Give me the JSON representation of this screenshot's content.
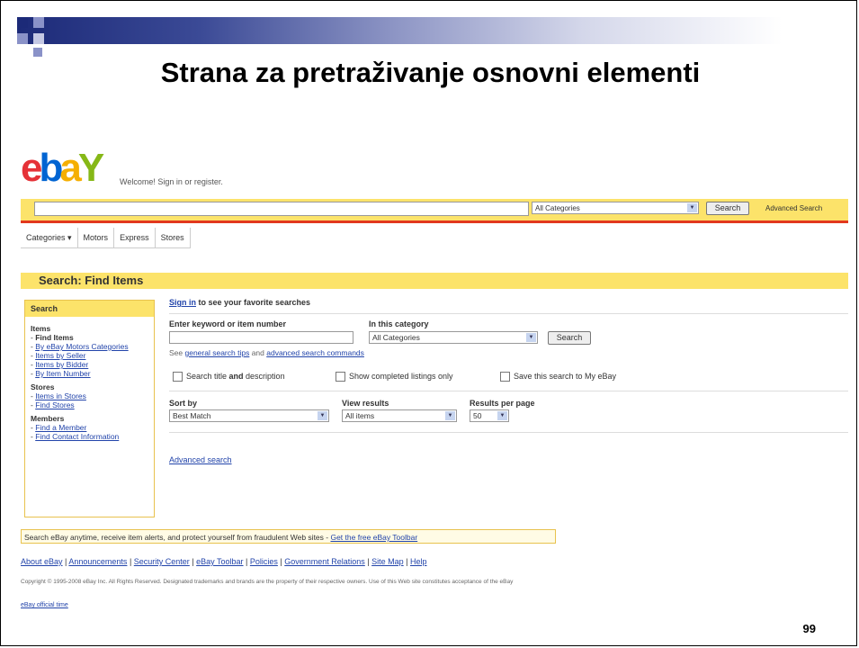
{
  "slide": {
    "title": "Strana za pretraživanje osnovni elementi",
    "page_number": "99"
  },
  "ebay": {
    "logo": {
      "e": "e",
      "b": "b",
      "a": "a",
      "y": "Y"
    },
    "welcome": "Welcome! Sign in or register.",
    "search_bar": {
      "category": "All Categories",
      "search_button": "Search",
      "advanced_link": "Advanced Search"
    },
    "nav_tabs": [
      "Categories ▾",
      "Motors",
      "Express",
      "Stores"
    ],
    "find_header": "Search: Find Items",
    "sidebar": {
      "header": "Search",
      "items_title": "Items",
      "items": [
        "Find Items",
        "By eBay Motors Categories",
        "Items by Seller",
        "Items by Bidder",
        "By Item Number"
      ],
      "stores_title": "Stores",
      "stores": [
        "Items in Stores",
        "Find Stores"
      ],
      "members_title": "Members",
      "members": [
        "Find a Member",
        "Find Contact Information"
      ]
    },
    "main": {
      "signin_link": "Sign in",
      "signin_text": " to see your favorite searches",
      "keyword_label": "Enter keyword or item number",
      "category_label": "In this category",
      "category_value": "All Categories",
      "search_button": "Search",
      "tips_prefix": "See ",
      "tips_link1": "general search tips",
      "tips_mid": " and ",
      "tips_link2": "advanced search commands",
      "chk_title_desc_a": "Search title ",
      "chk_title_desc_b": "and",
      "chk_title_desc_c": " description",
      "chk_completed": "Show completed listings only",
      "chk_save": "Save this search to My eBay",
      "sort_label": "Sort by",
      "sort_value": "Best Match",
      "view_label": "View results",
      "view_value": "All items",
      "perpage_label": "Results per page",
      "perpage_value": "50",
      "advanced_link": "Advanced search"
    },
    "toolbar_text": "Search eBay anytime, receive item alerts, and protect yourself from fraudulent Web sites - ",
    "toolbar_link": "Get the free eBay Toolbar",
    "footer_links": [
      "About eBay",
      "Announcements",
      "Security Center",
      "eBay Toolbar",
      "Policies",
      "Government Relations",
      "Site Map",
      "Help"
    ],
    "copyright": "Copyright © 1995-2008 eBay Inc. All Rights Reserved. Designated trademarks and brands are the property of their respective owners. Use of this Web site constitutes acceptance of the eBay",
    "official_time": "eBay official time"
  },
  "colors": {
    "ebay_yellow": "#fce36a",
    "slide_navy": "#1c2a78",
    "link_blue": "#2244aa"
  }
}
